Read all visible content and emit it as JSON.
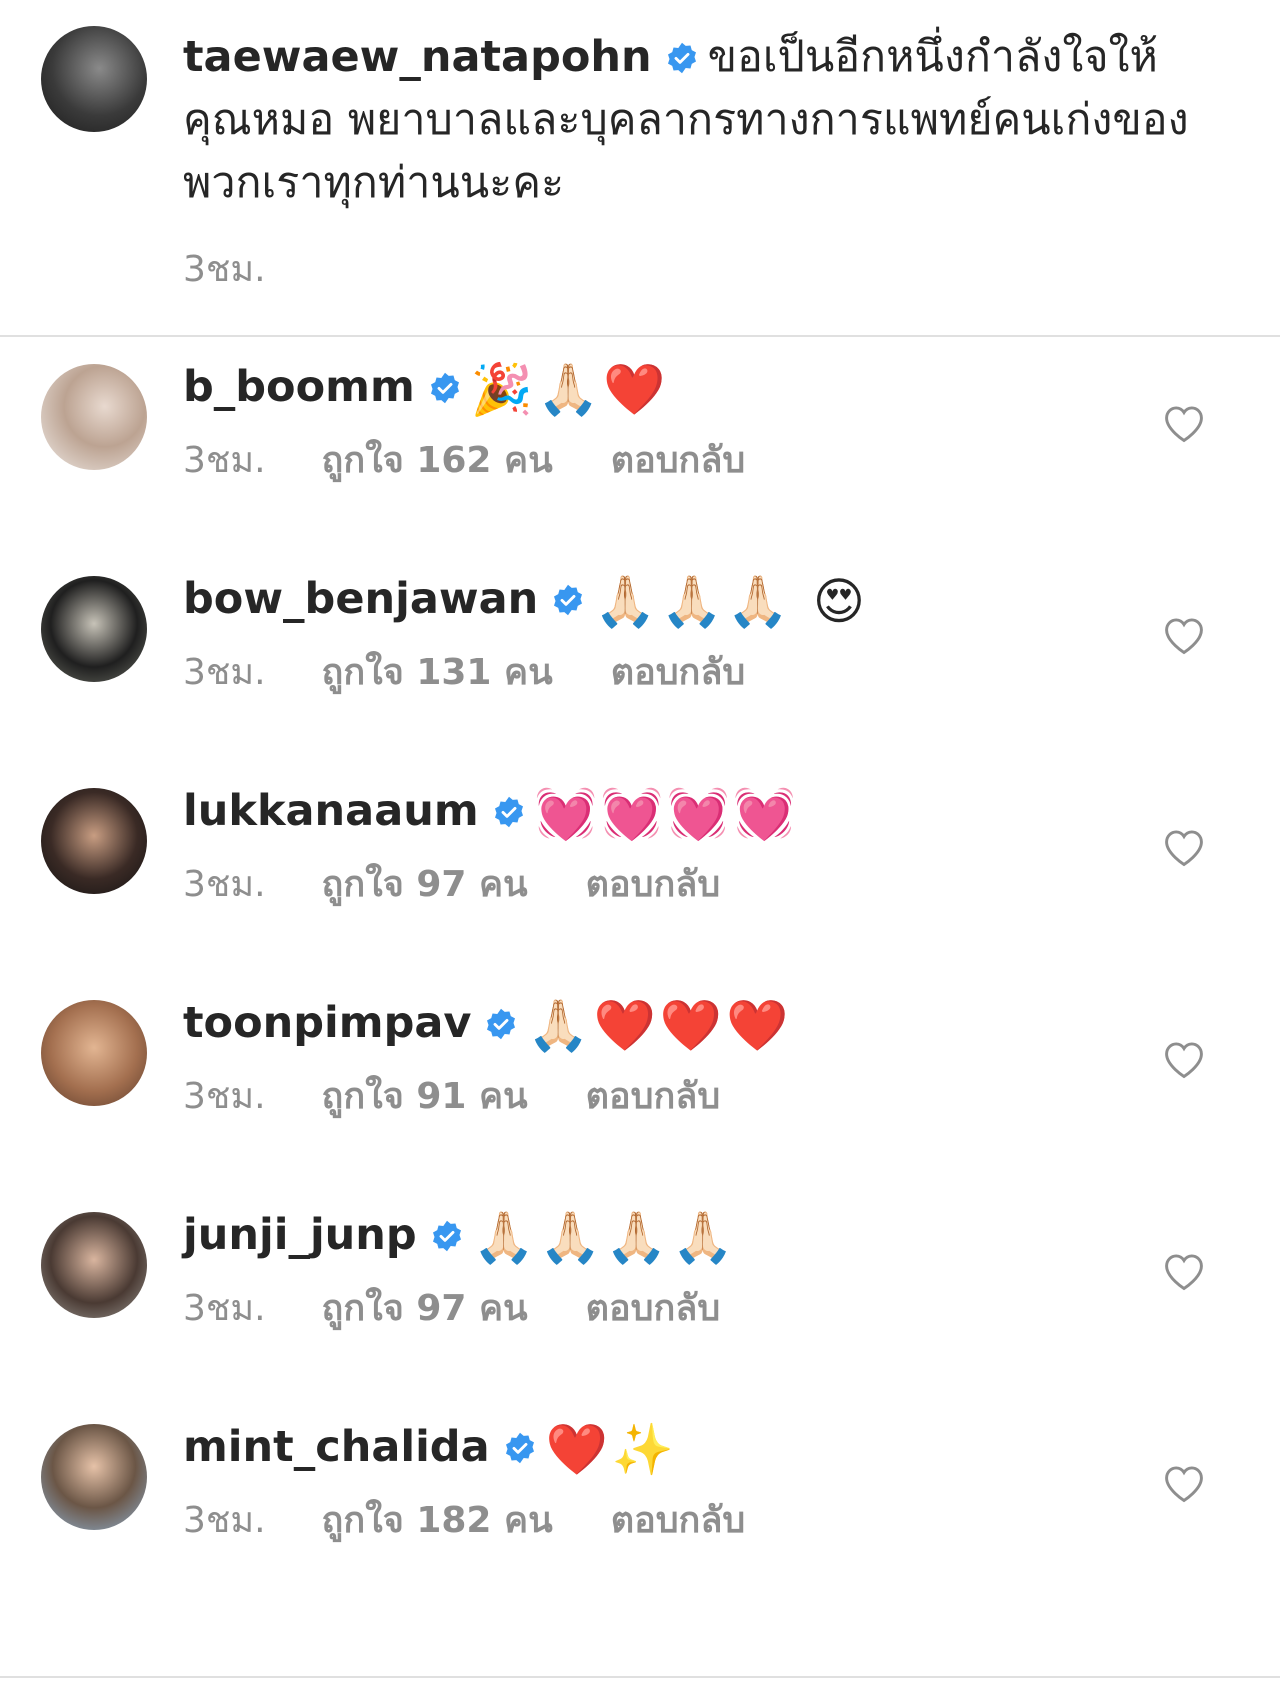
{
  "caption": {
    "username": "taewaew_natapohn",
    "text": "ขอเป็นอีกหนึ่งกำลังใจให้คุณหมอ พยาบาลและบุคลากรทางการแพทย์คนเก่งของพวกเราทุกท่านนะคะ",
    "time": "3ชม."
  },
  "comments": [
    {
      "username": "b_boomm",
      "emojis": "🎉🙏🏻❤️",
      "time": "3ชม.",
      "likes": "ถูกใจ 162 คน",
      "reply": "ตอบกลับ"
    },
    {
      "username": "bow_benjawan",
      "emojis": "🙏🏻🙏🏻🙏🏻 😍",
      "time": "3ชม.",
      "likes": "ถูกใจ 131 คน",
      "reply": "ตอบกลับ"
    },
    {
      "username": "lukkanaaum",
      "emojis": "💓💓💓💓",
      "time": "3ชม.",
      "likes": "ถูกใจ 97 คน",
      "reply": "ตอบกลับ"
    },
    {
      "username": "toonpimpav",
      "emojis": "🙏🏻❤️❤️❤️",
      "time": "3ชม.",
      "likes": "ถูกใจ 91 คน",
      "reply": "ตอบกลับ"
    },
    {
      "username": "junji_junp",
      "emojis": "🙏🏻🙏🏻🙏🏻🙏🏻",
      "time": "3ชม.",
      "likes": "ถูกใจ 97 คน",
      "reply": "ตอบกลับ"
    },
    {
      "username": "mint_chalida",
      "emojis": "❤️✨",
      "time": "3ชม.",
      "likes": "ถูกใจ 182 คน",
      "reply": "ตอบกลับ"
    }
  ],
  "colors": {
    "verified": "#3897f0",
    "text": "#262626",
    "secondary": "#8e8e8e",
    "divider": "#e0e0e0"
  },
  "icons": {
    "verified": "verified-badge-icon",
    "like": "heart-outline-icon"
  }
}
